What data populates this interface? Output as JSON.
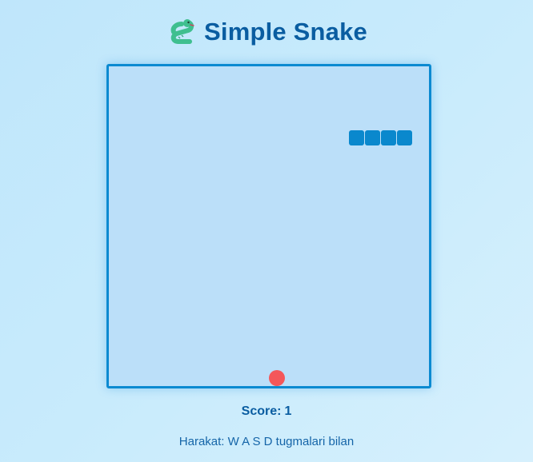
{
  "header": {
    "logo_icon": "snake-icon",
    "title": "Simple Snake"
  },
  "game": {
    "grid_cols": 20,
    "grid_rows": 20,
    "snake": [
      [
        15,
        4
      ],
      [
        16,
        4
      ],
      [
        17,
        4
      ],
      [
        18,
        4
      ]
    ],
    "food": [
      10,
      19
    ],
    "colors": {
      "snake": "#0a88cd",
      "food": "#f4575a",
      "board": "#bbdff9",
      "border": "#0b8ad1"
    }
  },
  "score": {
    "label": "Score:",
    "value": "1"
  },
  "controls": {
    "hint": "Harakat: W A S D tugmalari bilan"
  }
}
